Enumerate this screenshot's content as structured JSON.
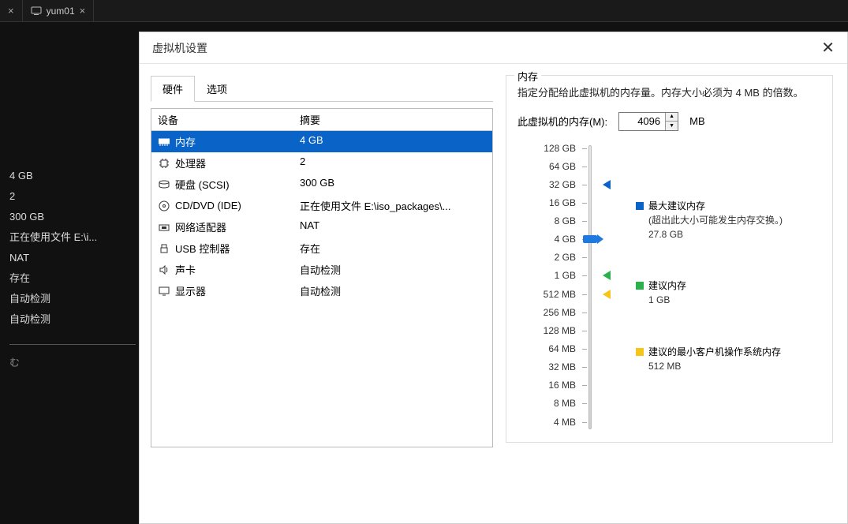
{
  "tabs": [
    {
      "label": ""
    },
    {
      "label": "yum01"
    }
  ],
  "side_values": [
    "4 GB",
    "2",
    "300 GB",
    "正在使用文件 E:\\i...",
    "NAT",
    "存在",
    "自动检测",
    "自动检测"
  ],
  "side_footer": "む",
  "dialog": {
    "title": "虚拟机设置",
    "tab_hw": "硬件",
    "tab_opt": "选项",
    "col_device": "设备",
    "col_summary": "摘要",
    "rows": [
      {
        "icon": "memory-icon",
        "name": "内存",
        "summary": "4 GB",
        "selected": true
      },
      {
        "icon": "cpu-icon",
        "name": "处理器",
        "summary": "2"
      },
      {
        "icon": "disk-icon",
        "name": "硬盘 (SCSI)",
        "summary": "300 GB"
      },
      {
        "icon": "cd-icon",
        "name": "CD/DVD (IDE)",
        "summary": "正在使用文件 E:\\iso_packages\\..."
      },
      {
        "icon": "nic-icon",
        "name": "网络适配器",
        "summary": "NAT"
      },
      {
        "icon": "usb-icon",
        "name": "USB 控制器",
        "summary": "存在"
      },
      {
        "icon": "sound-icon",
        "name": "声卡",
        "summary": "自动检测"
      },
      {
        "icon": "display-icon",
        "name": "显示器",
        "summary": "自动检测"
      }
    ]
  },
  "memory": {
    "legend": "内存",
    "desc": "指定分配给此虚拟机的内存量。内存大小必须为 4 MB 的倍数。",
    "input_label": "此虚拟机的内存(M):",
    "value": "4096",
    "unit": "MB",
    "ticks": [
      "128 GB",
      "64 GB",
      "32 GB",
      "16 GB",
      "8 GB",
      "4 GB",
      "2 GB",
      "1 GB",
      "512 MB",
      "256 MB",
      "128 MB",
      "64 MB",
      "32 MB",
      "16 MB",
      "8 MB",
      "4 MB"
    ],
    "markers": {
      "max": {
        "color": "#0a63c7",
        "tick": "32 GB"
      },
      "rec": {
        "color": "#2bb14c",
        "tick": "1 GB"
      },
      "min": {
        "color": "#f5c518",
        "tick": "512 MB"
      }
    },
    "thumb_tick": "4 GB",
    "legend_items": {
      "max_title": "最大建议内存",
      "max_note": "(超出此大小可能发生内存交换。)",
      "max_value": "27.8 GB",
      "rec_title": "建议内存",
      "rec_value": "1 GB",
      "min_title": "建议的最小客户机操作系统内存",
      "min_value": "512 MB"
    },
    "colors": {
      "max": "#0a63c7",
      "rec": "#2bb14c",
      "min": "#f5c518"
    }
  }
}
